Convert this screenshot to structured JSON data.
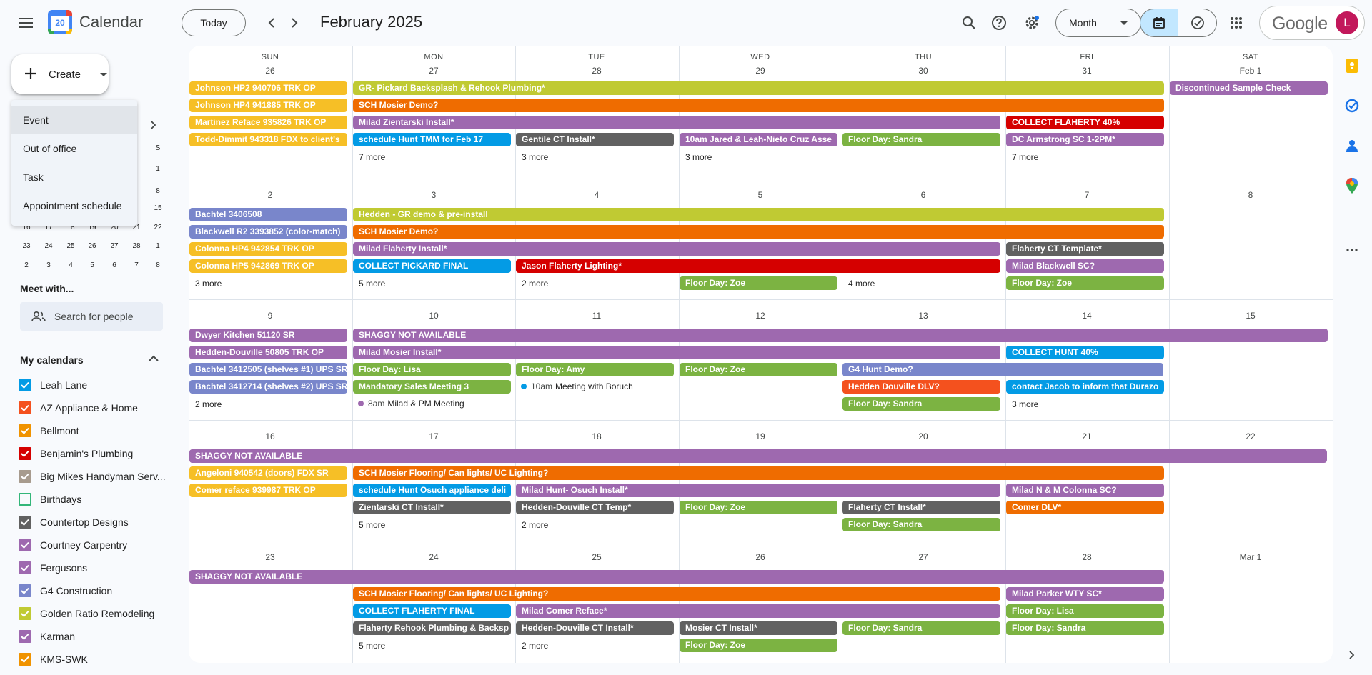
{
  "app": {
    "name": "Calendar",
    "logo_day": "20"
  },
  "header": {
    "today_label": "Today",
    "date_title": "February 2025",
    "view_label": "Month",
    "account_brand": "Google",
    "avatar_letter": "L"
  },
  "create": {
    "label": "Create",
    "menu": [
      "Event",
      "Out of office",
      "Task",
      "Appointment schedule"
    ]
  },
  "minical": {
    "weekday_visible": "S",
    "rows": [
      [
        "",
        "",
        "",
        "",
        "",
        "",
        "1"
      ],
      [
        "",
        "",
        "",
        "",
        "",
        "",
        "8"
      ],
      [
        "",
        "",
        "",
        "",
        "",
        "",
        "15"
      ],
      [
        "16",
        "17",
        "18",
        "19",
        "20",
        "21",
        "22"
      ],
      [
        "23",
        "24",
        "25",
        "26",
        "27",
        "28",
        "1"
      ],
      [
        "2",
        "3",
        "4",
        "5",
        "6",
        "7",
        "8"
      ]
    ]
  },
  "meet": {
    "title": "Meet with...",
    "placeholder": "Search for people"
  },
  "my_calendars": {
    "title": "My calendars",
    "items": [
      {
        "label": "Leah Lane",
        "color": "#039be5",
        "checked": true
      },
      {
        "label": "AZ Appliance & Home",
        "color": "#f4511e",
        "checked": true
      },
      {
        "label": "Bellmont",
        "color": "#f09300",
        "checked": true
      },
      {
        "label": "Benjamin's Plumbing",
        "color": "#d50000",
        "checked": true
      },
      {
        "label": "Big Mikes Handyman Serv...",
        "color": "#a79b8e",
        "checked": true
      },
      {
        "label": "Birthdays",
        "color": "#33b679",
        "checked": false
      },
      {
        "label": "Countertop Designs",
        "color": "#616161",
        "checked": true
      },
      {
        "label": "Courtney Carpentry",
        "color": "#9e69af",
        "checked": true
      },
      {
        "label": "Fergusons",
        "color": "#9e69af",
        "checked": true
      },
      {
        "label": "G4 Construction",
        "color": "#7986cb",
        "checked": true
      },
      {
        "label": "Golden Ratio Remodeling",
        "color": "#c0ca33",
        "checked": true
      },
      {
        "label": "Karman",
        "color": "#9e69af",
        "checked": true
      },
      {
        "label": "KMS-SWK",
        "color": "#f09300",
        "checked": true
      }
    ]
  },
  "colors": {
    "yellow": "#f6bf26",
    "olive": "#c0ca33",
    "orange": "#ef6c00",
    "purple": "#9e69af",
    "red": "#d50000",
    "blue": "#039be5",
    "graphite": "#616161",
    "green": "#7cb342",
    "lavender": "#7986cb",
    "tangerine": "#f4511e"
  },
  "month": {
    "weekdays": [
      "SUN",
      "MON",
      "TUE",
      "WED",
      "THU",
      "FRI",
      "SAT"
    ],
    "weeks": [
      {
        "days": [
          "26",
          "27",
          "28",
          "29",
          "30",
          "31",
          "Feb 1"
        ],
        "events": [
          {
            "d": 0,
            "span": 1,
            "row": 0,
            "c": "yellow",
            "t": "Johnson HP2 940706 TRK OP"
          },
          {
            "d": 1,
            "span": 5,
            "row": 0,
            "c": "olive",
            "t": "GR- Pickard Backsplash & Rehook Plumbing*"
          },
          {
            "d": 6,
            "span": 1,
            "row": 0,
            "c": "purple",
            "t": "Discontinued Sample Check"
          },
          {
            "d": 0,
            "span": 1,
            "row": 1,
            "c": "yellow",
            "t": "Johnson HP4 941885 TRK OP"
          },
          {
            "d": 1,
            "span": 5,
            "row": 1,
            "c": "orange",
            "t": "SCH Mosier Demo?"
          },
          {
            "d": 0,
            "span": 1,
            "row": 2,
            "c": "yellow",
            "t": "Martinez Reface 935826 TRK OP"
          },
          {
            "d": 1,
            "span": 4,
            "row": 2,
            "c": "purple",
            "t": "Milad Zientarski Install*"
          },
          {
            "d": 5,
            "span": 1,
            "row": 2,
            "c": "red",
            "t": "COLLECT FLAHERTY 40%"
          },
          {
            "d": 0,
            "span": 1,
            "row": 3,
            "c": "yellow",
            "t": "Todd-Dimmit 943318 FDX to client's"
          },
          {
            "d": 1,
            "span": 1,
            "row": 3,
            "c": "blue",
            "t": "schedule Hunt TMM for Feb 17"
          },
          {
            "d": 2,
            "span": 1,
            "row": 3,
            "c": "graphite",
            "t": "Gentile CT Install*"
          },
          {
            "d": 3,
            "span": 1,
            "row": 3,
            "c": "purple",
            "t": "10am Jared & Leah-Nieto Cruz Asse"
          },
          {
            "d": 4,
            "span": 1,
            "row": 3,
            "c": "green",
            "t": "Floor Day: Sandra"
          },
          {
            "d": 5,
            "span": 1,
            "row": 3,
            "c": "purple",
            "t": "DC Armstrong SC 1-2PM*"
          }
        ],
        "more": [
          {
            "d": 1,
            "row": 4,
            "t": "7 more"
          },
          {
            "d": 2,
            "row": 4,
            "t": "3 more"
          },
          {
            "d": 3,
            "row": 4,
            "t": "3 more"
          },
          {
            "d": 5,
            "row": 4,
            "t": "7 more"
          }
        ],
        "dots": []
      },
      {
        "days": [
          "2",
          "3",
          "4",
          "5",
          "6",
          "7",
          "8"
        ],
        "events": [
          {
            "d": 0,
            "span": 1,
            "row": 0,
            "c": "lavender",
            "t": "Bachtel 3406508"
          },
          {
            "d": 1,
            "span": 5,
            "row": 0,
            "c": "olive",
            "t": "Hedden - GR demo & pre-install"
          },
          {
            "d": 0,
            "span": 1,
            "row": 1,
            "c": "lavender",
            "t": "Blackwell R2 3393852 (color-match)"
          },
          {
            "d": 1,
            "span": 5,
            "row": 1,
            "c": "orange",
            "t": "SCH Mosier Demo?"
          },
          {
            "d": 0,
            "span": 1,
            "row": 2,
            "c": "yellow",
            "t": "Colonna HP4 942854 TRK OP"
          },
          {
            "d": 1,
            "span": 4,
            "row": 2,
            "c": "purple",
            "t": "Milad Flaherty Install*"
          },
          {
            "d": 5,
            "span": 1,
            "row": 2,
            "c": "graphite",
            "t": "Flaherty CT Template*"
          },
          {
            "d": 0,
            "span": 1,
            "row": 3,
            "c": "yellow",
            "t": "Colonna HP5 942869 TRK OP"
          },
          {
            "d": 1,
            "span": 1,
            "row": 3,
            "c": "blue",
            "t": "COLLECT PICKARD FINAL"
          },
          {
            "d": 2,
            "span": 3,
            "row": 3,
            "c": "red",
            "t": "Jason Flaherty Lighting*"
          },
          {
            "d": 5,
            "span": 1,
            "row": 3,
            "c": "purple",
            "t": "Milad Blackwell SC?"
          },
          {
            "d": 3,
            "span": 1,
            "row": 4,
            "c": "green",
            "t": "Floor Day: Zoe"
          },
          {
            "d": 5,
            "span": 1,
            "row": 4,
            "c": "green",
            "t": "Floor Day: Zoe"
          }
        ],
        "more": [
          {
            "d": 0,
            "row": 4,
            "t": "3 more"
          },
          {
            "d": 1,
            "row": 4,
            "t": "5 more"
          },
          {
            "d": 2,
            "row": 4,
            "t": "2 more"
          },
          {
            "d": 4,
            "row": 4,
            "t": "4 more"
          }
        ],
        "dots": []
      },
      {
        "days": [
          "9",
          "10",
          "11",
          "12",
          "13",
          "14",
          "15"
        ],
        "events": [
          {
            "d": 0,
            "span": 1,
            "row": 0,
            "c": "purple",
            "t": "Dwyer Kitchen 51120 SR"
          },
          {
            "d": 1,
            "span": 6,
            "row": 0,
            "c": "purple",
            "t": "SHAGGY NOT AVAILABLE"
          },
          {
            "d": 0,
            "span": 1,
            "row": 1,
            "c": "purple",
            "t": "Hedden-Douville 50805 TRK OP"
          },
          {
            "d": 1,
            "span": 4,
            "row": 1,
            "c": "purple",
            "t": "Milad Mosier Install*"
          },
          {
            "d": 5,
            "span": 1,
            "row": 1,
            "c": "blue",
            "t": "COLLECT HUNT 40%"
          },
          {
            "d": 0,
            "span": 1,
            "row": 2,
            "c": "lavender",
            "t": "Bachtel 3412505 (shelves #1) UPS SR"
          },
          {
            "d": 1,
            "span": 1,
            "row": 2,
            "c": "green",
            "t": "Floor Day: Lisa"
          },
          {
            "d": 2,
            "span": 1,
            "row": 2,
            "c": "green",
            "t": "Floor Day: Amy"
          },
          {
            "d": 3,
            "span": 1,
            "row": 2,
            "c": "green",
            "t": "Floor Day: Zoe"
          },
          {
            "d": 4,
            "span": 2,
            "row": 2,
            "c": "lavender",
            "t": "G4 Hunt Demo?"
          },
          {
            "d": 0,
            "span": 1,
            "row": 3,
            "c": "lavender",
            "t": "Bachtel 3412714 (shelves #2) UPS SR"
          },
          {
            "d": 1,
            "span": 1,
            "row": 3,
            "c": "green",
            "t": "Mandatory Sales Meeting 3"
          },
          {
            "d": 4,
            "span": 1,
            "row": 3,
            "c": "tangerine",
            "t": "Hedden Douville DLV?"
          },
          {
            "d": 5,
            "span": 1,
            "row": 3,
            "c": "blue",
            "t": "contact Jacob to inform that Durazo"
          },
          {
            "d": 4,
            "span": 1,
            "row": 4,
            "c": "green",
            "t": "Floor Day: Sandra"
          }
        ],
        "more": [
          {
            "d": 0,
            "row": 4,
            "t": "2 more"
          },
          {
            "d": 5,
            "row": 4,
            "t": "3 more"
          }
        ],
        "dots": [
          {
            "d": 2,
            "row": 3,
            "c": "blue",
            "time": "10am",
            "t": "Meeting with Boruch"
          },
          {
            "d": 1,
            "row": 4,
            "c": "purple",
            "time": "8am",
            "t": "Milad & PM Meeting"
          }
        ]
      },
      {
        "days": [
          "16",
          "17",
          "18",
          "19",
          "20",
          "21",
          "22"
        ],
        "events": [
          {
            "d": 0,
            "span": 7,
            "row": 0,
            "c": "purple",
            "t": "SHAGGY NOT AVAILABLE"
          },
          {
            "d": 0,
            "span": 1,
            "row": 1,
            "c": "yellow",
            "t": "Angeloni 940542 (doors) FDX SR"
          },
          {
            "d": 1,
            "span": 5,
            "row": 1,
            "c": "orange",
            "t": "SCH Mosier Flooring/ Can lights/ UC Lighting?"
          },
          {
            "d": 0,
            "span": 1,
            "row": 2,
            "c": "yellow",
            "t": "Comer reface 939987 TRK OP"
          },
          {
            "d": 1,
            "span": 1,
            "row": 2,
            "c": "blue",
            "t": "schedule Hunt Osuch appliance deli"
          },
          {
            "d": 2,
            "span": 3,
            "row": 2,
            "c": "purple",
            "t": "Milad Hunt- Osuch Install*"
          },
          {
            "d": 5,
            "span": 1,
            "row": 2,
            "c": "purple",
            "t": "Milad N & M Colonna SC?"
          },
          {
            "d": 1,
            "span": 1,
            "row": 3,
            "c": "graphite",
            "t": "Zientarski CT Install*"
          },
          {
            "d": 2,
            "span": 1,
            "row": 3,
            "c": "graphite",
            "t": "Hedden-Douville CT Temp*"
          },
          {
            "d": 3,
            "span": 1,
            "row": 3,
            "c": "green",
            "t": "Floor Day: Zoe"
          },
          {
            "d": 4,
            "span": 1,
            "row": 3,
            "c": "graphite",
            "t": "Flaherty CT Install*"
          },
          {
            "d": 5,
            "span": 1,
            "row": 3,
            "c": "orange",
            "t": "Comer DLV*"
          },
          {
            "d": 4,
            "span": 1,
            "row": 4,
            "c": "green",
            "t": "Floor Day: Sandra"
          }
        ],
        "more": [
          {
            "d": 1,
            "row": 4,
            "t": "5 more"
          },
          {
            "d": 2,
            "row": 4,
            "t": "2 more"
          }
        ],
        "dots": []
      },
      {
        "days": [
          "23",
          "24",
          "25",
          "26",
          "27",
          "28",
          "Mar 1"
        ],
        "events": [
          {
            "d": 0,
            "span": 6,
            "row": 0,
            "c": "purple",
            "t": "SHAGGY NOT AVAILABLE"
          },
          {
            "d": 1,
            "span": 4,
            "row": 1,
            "c": "orange",
            "t": "SCH Mosier Flooring/ Can lights/ UC Lighting?"
          },
          {
            "d": 5,
            "span": 1,
            "row": 1,
            "c": "purple",
            "t": "Milad Parker WTY SC*"
          },
          {
            "d": 1,
            "span": 1,
            "row": 2,
            "c": "blue",
            "t": "COLLECT FLAHERTY FINAL"
          },
          {
            "d": 2,
            "span": 3,
            "row": 2,
            "c": "purple",
            "t": "Milad Comer Reface*"
          },
          {
            "d": 5,
            "span": 1,
            "row": 2,
            "c": "green",
            "t": "Floor Day: Lisa"
          },
          {
            "d": 1,
            "span": 1,
            "row": 3,
            "c": "graphite",
            "t": "Flaherty Rehook Plumbing & Backsp"
          },
          {
            "d": 2,
            "span": 1,
            "row": 3,
            "c": "graphite",
            "t": "Hedden-Douville CT Install*"
          },
          {
            "d": 3,
            "span": 1,
            "row": 3,
            "c": "graphite",
            "t": "Mosier CT Install*"
          },
          {
            "d": 4,
            "span": 1,
            "row": 3,
            "c": "green",
            "t": "Floor Day: Sandra"
          },
          {
            "d": 5,
            "span": 1,
            "row": 3,
            "c": "green",
            "t": "Floor Day: Sandra"
          },
          {
            "d": 3,
            "span": 1,
            "row": 4,
            "c": "green",
            "t": "Floor Day: Zoe"
          }
        ],
        "more": [
          {
            "d": 1,
            "row": 4,
            "t": "5 more"
          },
          {
            "d": 2,
            "row": 4,
            "t": "2 more"
          }
        ],
        "dots": []
      }
    ]
  }
}
